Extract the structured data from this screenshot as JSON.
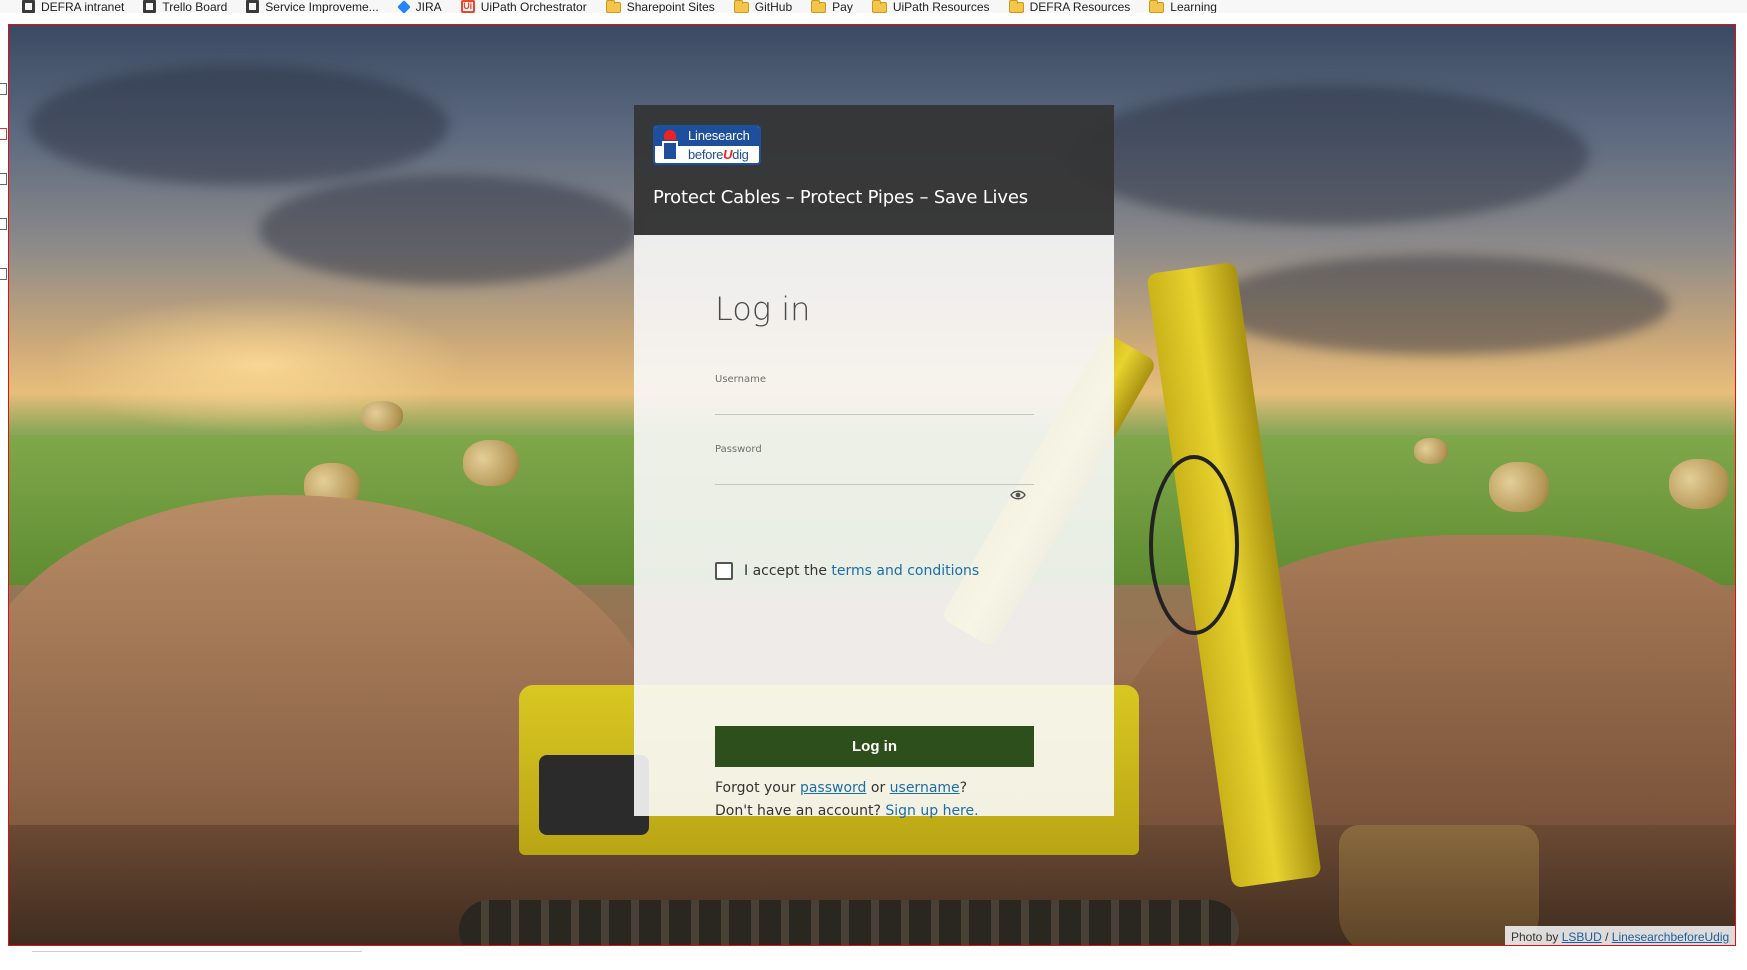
{
  "bookmarks": [
    {
      "label": "DEFRA intranet",
      "icon": "doc-icon"
    },
    {
      "label": "Trello Board",
      "icon": "doc-icon"
    },
    {
      "label": "Service Improveme...",
      "icon": "doc-icon"
    },
    {
      "label": "JIRA",
      "icon": "jira-icon"
    },
    {
      "label": "UiPath Orchestrator",
      "icon": "uipath-icon"
    },
    {
      "label": "Sharepoint Sites",
      "icon": "folder-icon"
    },
    {
      "label": "GitHub",
      "icon": "folder-icon"
    },
    {
      "label": "Pay",
      "icon": "folder-icon"
    },
    {
      "label": "UiPath Resources",
      "icon": "folder-icon"
    },
    {
      "label": "DEFRA Resources",
      "icon": "folder-icon"
    },
    {
      "label": "Learning",
      "icon": "folder-icon"
    }
  ],
  "header": {
    "logo_line1": "Linesearch",
    "logo_line2_a": "before",
    "logo_line2_u": "U",
    "logo_line2_b": "dig",
    "tagline": "Protect Cables – Protect Pipes – Save Lives"
  },
  "login": {
    "title": "Log in",
    "username_label": "Username",
    "username_value": "",
    "password_label": "Password",
    "password_value": "",
    "terms_prefix": "I accept the",
    "terms_link": "terms and conditions",
    "terms_checked": false,
    "button_label": "Log in",
    "forgot_prefix": "Forgot your",
    "forgot_password": "password",
    "forgot_or": "or",
    "forgot_username": "username",
    "forgot_suffix": "?",
    "signup_prefix": "Don't have an account?",
    "signup_link": "Sign up here."
  },
  "photo_credit": {
    "prefix": "Photo by",
    "author": "LSBUD",
    "sep": "/",
    "source": "LinesearchbeforeUdig"
  },
  "colors": {
    "header_bg": "#343434",
    "button_bg": "#2d4f1c",
    "link": "#1c6ea8",
    "viewport_border": "#dd1111"
  }
}
